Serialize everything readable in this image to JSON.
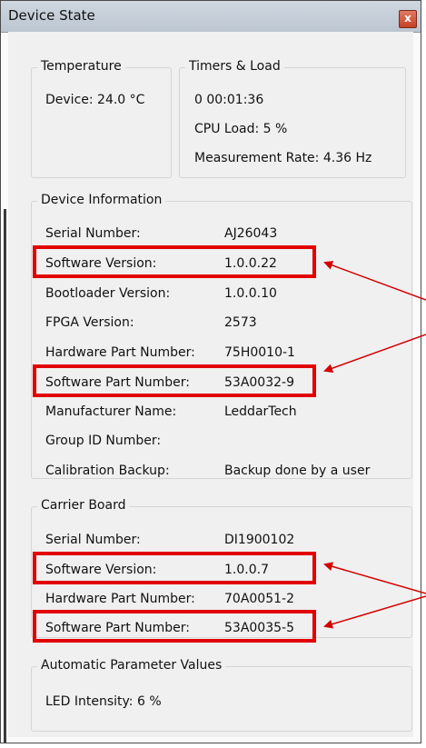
{
  "window": {
    "title": "Device State",
    "close_label": "x"
  },
  "temperature": {
    "title": "Temperature",
    "device": "Device: 24.0 °C"
  },
  "timers": {
    "title": "Timers & Load",
    "uptime": "0 00:01:36",
    "cpu_load": "CPU Load: 5 %",
    "measurement_rate": "Measurement Rate:  4.36 Hz"
  },
  "device_info": {
    "title": "Device Information",
    "rows": [
      {
        "label": "Serial Number:",
        "value": "AJ26043"
      },
      {
        "label": "Software Version:",
        "value": "1.0.0.22"
      },
      {
        "label": "Bootloader Version:",
        "value": "1.0.0.10"
      },
      {
        "label": "FPGA Version:",
        "value": "2573"
      },
      {
        "label": "Hardware Part Number:",
        "value": "75H0010-1"
      },
      {
        "label": "Software Part Number:",
        "value": "53A0032-9"
      },
      {
        "label": "Manufacturer Name:",
        "value": "LeddarTech"
      },
      {
        "label": "Group ID Number:",
        "value": ""
      },
      {
        "label": "Calibration Backup:",
        "value": "Backup done by a user"
      }
    ]
  },
  "carrier_board": {
    "title": "Carrier Board",
    "rows": [
      {
        "label": "Serial Number:",
        "value": "DI1900102"
      },
      {
        "label": "Software Version:",
        "value": "1.0.0.7"
      },
      {
        "label": "Hardware Part Number:",
        "value": "70A0051-2"
      },
      {
        "label": "Software Part Number:",
        "value": "53A0035-5"
      }
    ]
  },
  "auto_params": {
    "title": "Automatic Parameter Values",
    "led_intensity": "LED Intensity: 6 %"
  },
  "colors": {
    "highlight": "#e20000",
    "arrow": "#d40000"
  }
}
